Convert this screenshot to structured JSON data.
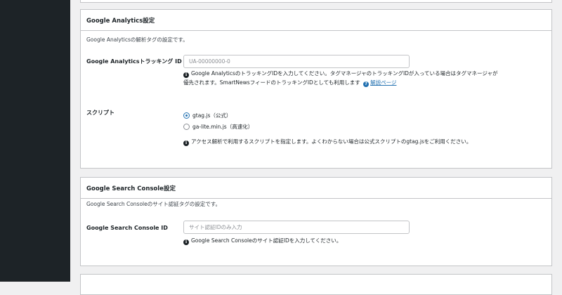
{
  "ga_section": {
    "title": "Google Analytics設定",
    "description": "Google Analyticsの解析タグの設定です。",
    "tracking": {
      "label": "Google Analyticsトラッキング ID",
      "placeholder": "UA-00000000-0",
      "value": "",
      "help_line1": "Google AnalyticsのトラッキングIDを入力してください。タグマネージャのトラッキングIDが入っている場合はタグマネージャが",
      "help_line2": "優先されます。SmartNewsフィードのトラッキングIDとしても利用します",
      "help_link": "解説ページ"
    },
    "script": {
      "label": "スクリプト",
      "options": [
        "gtag.js（公式）",
        "ga-lite.min.js（高速化）"
      ],
      "selected": "gtag.js（公式）",
      "help": "アクセス解析で利用するスクリプトを指定します。よくわからない場合は公式スクリプトのgtag.jsをご利用ください。"
    }
  },
  "gsc_section": {
    "title": "Google Search Console設定",
    "description": "Google Search Consoleのサイト認証タグの設定です。",
    "id_field": {
      "label": "Google Search Console ID",
      "placeholder": "サイト認証IDのみ入力",
      "value": "",
      "help": "Google Search Consoleのサイト認証IDを入力してください。"
    }
  },
  "icons": {
    "info": "info-circle-icon",
    "help": "question-circle-icon"
  },
  "colors": {
    "admin_sidebar": "#1d2327",
    "background": "#f0f0f1",
    "link": "#2271b1",
    "border": "#c3c4c7"
  }
}
